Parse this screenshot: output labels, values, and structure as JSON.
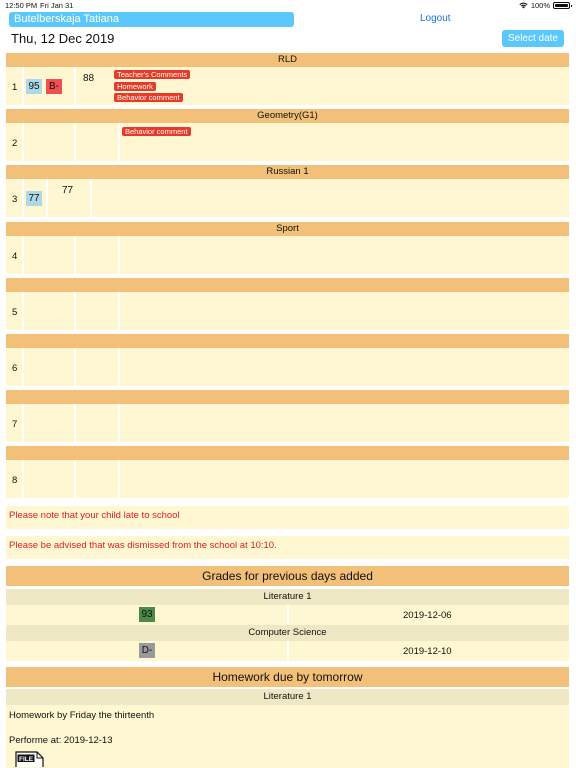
{
  "status_bar": {
    "time": "12:50 PM",
    "date": "Fri Jan 31",
    "battery": "100%"
  },
  "header": {
    "user_name": "Butelberskaja Tatiana",
    "logout_label": "Logout",
    "date": "Thu, 12 Dec 2019",
    "select_date_label": "Select date"
  },
  "lessons": [
    {
      "number": "1",
      "subject": "RLD",
      "grades": [
        "95",
        "B-"
      ],
      "mark": "88",
      "tags": [
        "Teacher's Comments",
        "Homework",
        "Behavior comment"
      ]
    },
    {
      "number": "2",
      "subject": "Geometry(G1)",
      "tags": [
        "Behavior comment"
      ]
    },
    {
      "number": "3",
      "subject": "Russian 1",
      "grades": [
        "77"
      ],
      "mark": "77"
    },
    {
      "number": "4",
      "subject": "Sport"
    },
    {
      "number": "5",
      "subject": ""
    },
    {
      "number": "6",
      "subject": ""
    },
    {
      "number": "7",
      "subject": ""
    },
    {
      "number": "8",
      "subject": ""
    }
  ],
  "notices": [
    "Please note that your child late to school",
    "Please be advised that was dismissed from the school at 10:10."
  ],
  "previous_grades": {
    "title": "Grades for previous days added",
    "items": [
      {
        "subject": "Literature 1",
        "grade": "93",
        "date": "2019-12-06"
      },
      {
        "subject": "Computer Science",
        "grade": "D-",
        "date": "2019-12-10"
      }
    ]
  },
  "homework": {
    "title": "Homework due by tomorrow",
    "subject": "Literature 1",
    "text": "Homework by Friday the thirteenth",
    "perform_at": "Performe at: 2019-12-13",
    "file_icon_label": "FILE"
  },
  "colors": {
    "accent_blue": "#5ac8fa",
    "header_orange": "#f2c078",
    "row_cream": "#fff7d2",
    "tag_red": "#e83a28",
    "grade_blue": "#add8e6",
    "grade_red": "#f05050",
    "grade_green": "#4a8a4a",
    "grade_gray": "#9a9a9a"
  }
}
